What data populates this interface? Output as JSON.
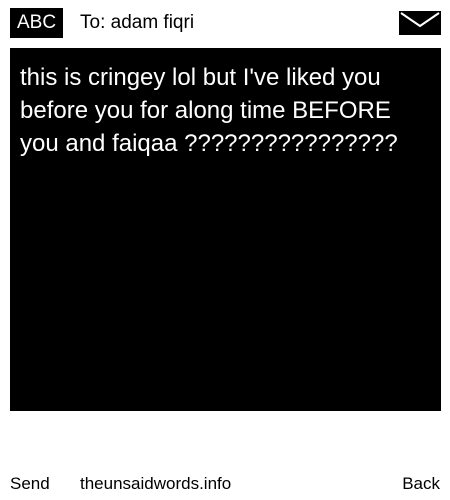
{
  "header": {
    "input_mode": "ABC",
    "recipient": "To: adam fiqri",
    "icon": "envelope-icon"
  },
  "message": {
    "text": "this is cringey lol but I've liked you before you for along time BEFORE you and faiqaa ????????????????"
  },
  "footer": {
    "left_softkey": "Send",
    "site": "theunsaidwords.info",
    "right_softkey": "Back"
  },
  "colors": {
    "background": "#ffffff",
    "message_background": "#000000",
    "message_text": "#ffffff",
    "text": "#000000"
  }
}
